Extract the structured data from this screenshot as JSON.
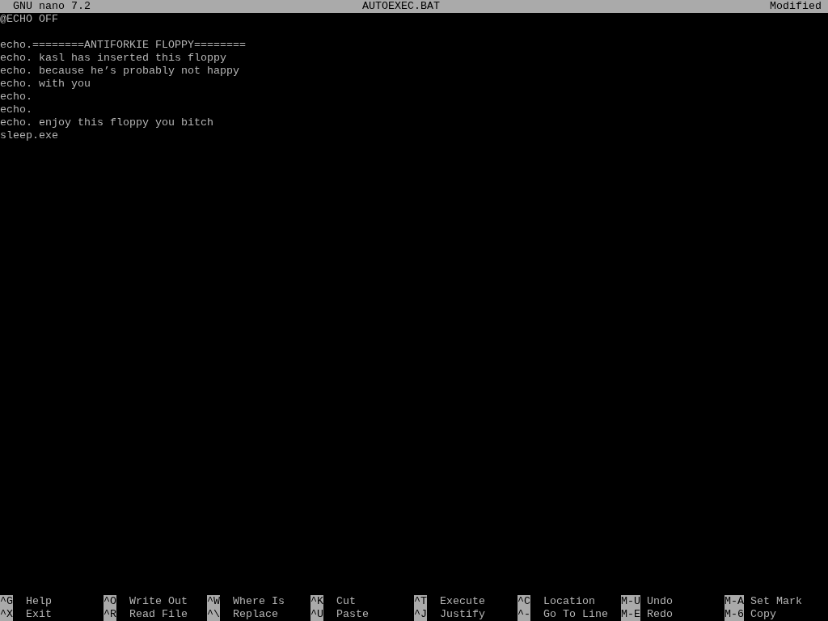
{
  "title_bar": {
    "app": "GNU nano 7.2",
    "filename": "AUTOEXEC.BAT",
    "status": "Modified"
  },
  "lines": [
    {
      "kind": "text",
      "text": "@ECHO OFF"
    },
    {
      "kind": "blank"
    },
    {
      "kind": "text",
      "text": "echo.========ANTIFORKIE FLOPPY========"
    },
    {
      "kind": "text",
      "text": "echo. kasl has inserted this floppy"
    },
    {
      "kind": "text",
      "text": "echo. because he’s probably not happy"
    },
    {
      "kind": "text",
      "text": "echo. with you"
    },
    {
      "kind": "text",
      "text": "echo."
    },
    {
      "kind": "text",
      "text": "echo."
    },
    {
      "kind": "text",
      "text": "echo. enjoy this floppy you bitch"
    },
    {
      "kind": "text",
      "text": "sleep.exe"
    }
  ],
  "shortcut_rows": [
    [
      {
        "key": "^G",
        "label": "Help"
      },
      {
        "key": "^O",
        "label": "Write Out"
      },
      {
        "key": "^W",
        "label": "Where Is"
      },
      {
        "key": "^K",
        "label": "Cut"
      },
      {
        "key": "^T",
        "label": "Execute"
      },
      {
        "key": "^C",
        "label": "Location"
      },
      {
        "key": "M-U",
        "label": "Undo"
      },
      {
        "key": "M-A",
        "label": "Set Mark"
      }
    ],
    [
      {
        "key": "^X",
        "label": "Exit"
      },
      {
        "key": "^R",
        "label": "Read File"
      },
      {
        "key": "^\\",
        "label": "Replace"
      },
      {
        "key": "^U",
        "label": "Paste"
      },
      {
        "key": "^J",
        "label": "Justify"
      },
      {
        "key": "^-",
        "label": "Go To Line"
      },
      {
        "key": "M-E",
        "label": "Redo"
      },
      {
        "key": "M-6",
        "label": "Copy"
      }
    ]
  ]
}
